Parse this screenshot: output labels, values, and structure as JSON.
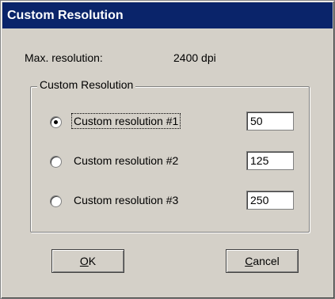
{
  "window": {
    "title": "Custom Resolution"
  },
  "max_resolution": {
    "label": "Max. resolution:",
    "value": "2400 dpi"
  },
  "group": {
    "label": "Custom Resolution",
    "options": [
      {
        "label": "Custom resolution #1",
        "value": "50",
        "selected": true
      },
      {
        "label": "Custom resolution #2",
        "value": "125",
        "selected": false
      },
      {
        "label": "Custom resolution #3",
        "value": "250",
        "selected": false
      }
    ]
  },
  "buttons": {
    "ok": {
      "mnemonic": "O",
      "rest": "K"
    },
    "cancel": {
      "mnemonic": "C",
      "rest": "ancel"
    }
  },
  "colors": {
    "titlebar": "#0a246a",
    "dialog_face": "#d4d0c8"
  }
}
